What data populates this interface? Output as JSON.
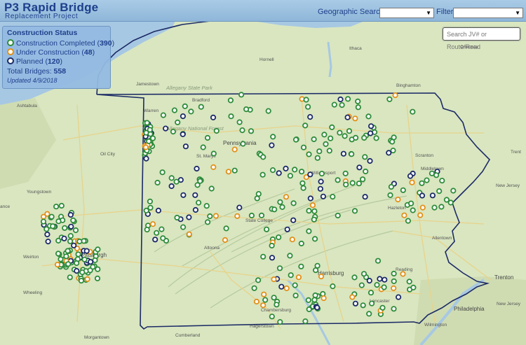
{
  "header": {
    "title": "P3 Rapid Bridge",
    "subtitle": "Replacement Project",
    "geo_search_label": "Geographic Search",
    "filter_label": "Filter",
    "search_placeholder": "Search JV# or Route/Road"
  },
  "legend": {
    "heading": "Construction Status",
    "items": [
      {
        "label": "Construction Completed",
        "count": "390",
        "color": "#2e8b3a"
      },
      {
        "label": "Under Construction",
        "count": "48",
        "color": "#e29019"
      },
      {
        "label": "Planned",
        "count": "120",
        "color": "#1c2a66"
      }
    ],
    "total_label": "Total Bridges:",
    "total_value": "558",
    "updated": "Updated 4/9/2018"
  },
  "map": {
    "places": [
      "Ashtabula",
      "Jamestown",
      "Hornell",
      "Ithaca",
      "Binghamton",
      "Oneonta",
      "Warren",
      "Bradford",
      "Allegany State Park",
      "Allegany National Forest",
      "Oil City",
      "St. Marys",
      "Pennsylvania",
      "Williamsport",
      "Scranton",
      "Youngstown",
      "State College",
      "Hazleton",
      "Middletown",
      "New Jersey",
      "Pittsburgh",
      "Altoona",
      "Allentown",
      "Weirton",
      "Harrisburg",
      "Reading",
      "Trenton",
      "Wheeling",
      "Lancaster",
      "Chambersburg",
      "Philadelphia",
      "Morgantown",
      "Cumberland",
      "Hagerstown",
      "Wilmington",
      "New Jersey",
      "ance",
      "Trent"
    ],
    "colors": {
      "completed": "#2e8b3a",
      "construction": "#e29019",
      "planned": "#1c2a66",
      "border": "#1c2a66",
      "water": "#a7c8e3",
      "land": "#d9e6c0"
    }
  }
}
